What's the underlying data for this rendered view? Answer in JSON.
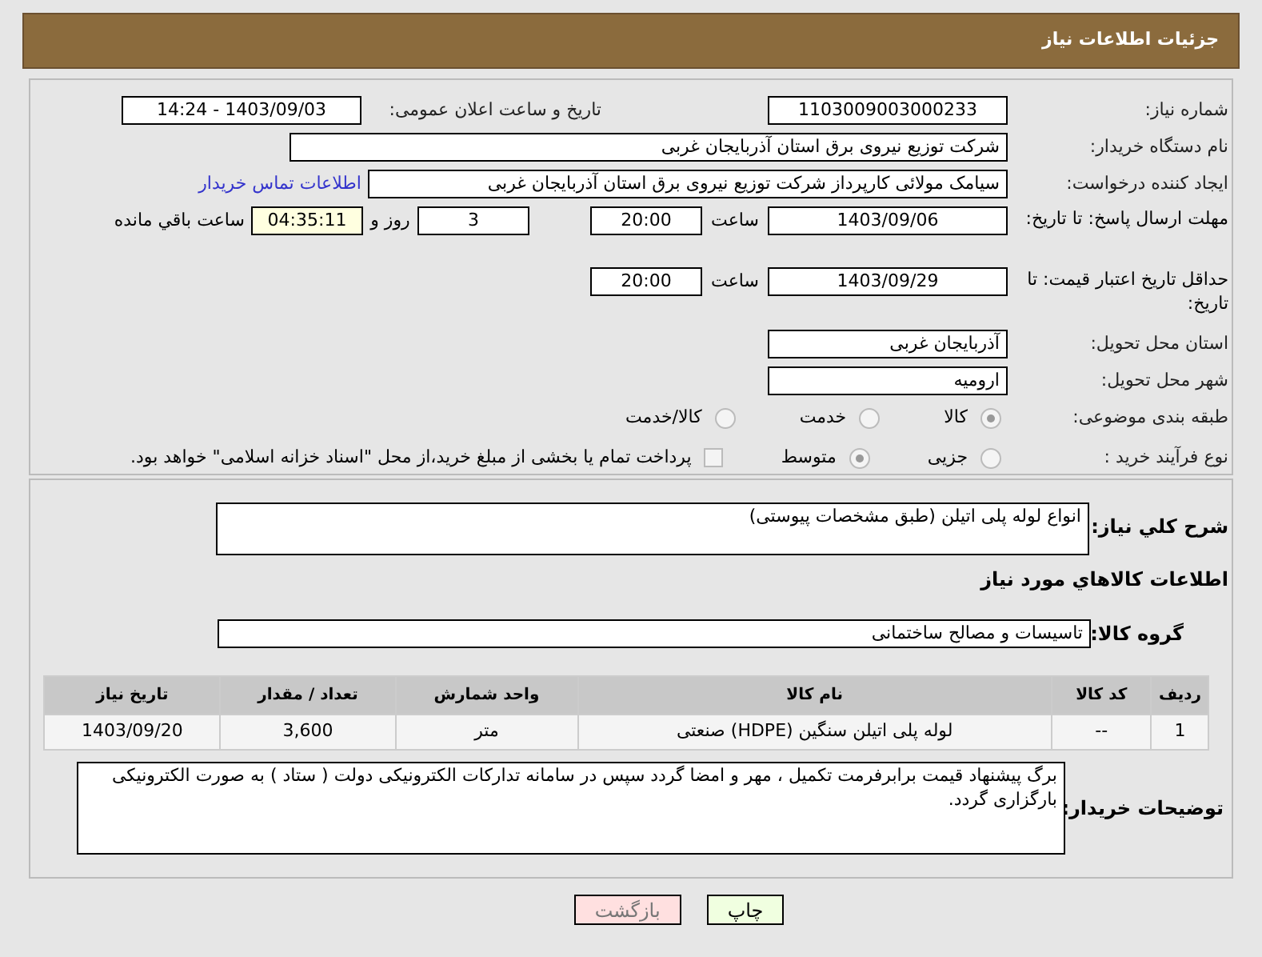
{
  "header": {
    "title": "جزئیات اطلاعات نیاز"
  },
  "need_number": {
    "label": "شماره نیاز:",
    "value": "1103009003000233"
  },
  "announce": {
    "label": "تاریخ و ساعت اعلان عمومی:",
    "value": "1403/09/03 - 14:24"
  },
  "buyer": {
    "label": "نام دستگاه خریدار:",
    "value": "شرکت توزیع نیروی برق استان آذربایجان غربی"
  },
  "creator": {
    "label": "ایجاد کننده درخواست:",
    "value": "سیامک مولائی کارپرداز شرکت توزیع نیروی برق استان آذربایجان غربی",
    "link": "اطلاعات تماس خریدار"
  },
  "deadline": {
    "label": "مهلت ارسال پاسخ: تا تاریخ:",
    "date": "1403/09/06",
    "time_label": "ساعت",
    "time": "20:00",
    "days": "3",
    "days_label": "روز و",
    "remaining": "04:35:11",
    "remaining_label": "ساعت باقي مانده"
  },
  "validity": {
    "label": "حداقل تاریخ اعتبار قیمت: تا تاریخ:",
    "date": "1403/09/29",
    "time_label": "ساعت",
    "time": "20:00"
  },
  "province": {
    "label": "استان محل تحویل:",
    "value": "آذربایجان غربی"
  },
  "city": {
    "label": "شهر محل تحویل:",
    "value": "ارومیه"
  },
  "category": {
    "label": "طبقه بندی موضوعی:",
    "options": [
      {
        "label": "کالا",
        "selected": true
      },
      {
        "label": "خدمت",
        "selected": false
      },
      {
        "label": "کالا/خدمت",
        "selected": false
      }
    ]
  },
  "process": {
    "label": "نوع فرآیند خرید :",
    "options": [
      {
        "kind": "radio",
        "label": "جزیی",
        "selected": false
      },
      {
        "kind": "radio",
        "label": "متوسط",
        "selected": true
      },
      {
        "kind": "checkbox",
        "label": "پرداخت تمام یا بخشی از مبلغ خرید،از محل \"اسناد خزانه اسلامی\" خواهد بود.",
        "checked": false
      }
    ]
  },
  "description": {
    "label": "شرح کلي نیاز:",
    "value": "انواع لوله پلی اتیلن (طبق مشخصات پیوستی)"
  },
  "items_heading": "اطلاعات کالاهاي مورد نیاز",
  "group": {
    "label": "گروه کالا:",
    "value": "تاسیسات و مصالح ساختمانی"
  },
  "table": {
    "columns": [
      "ردیف",
      "کد کالا",
      "نام کالا",
      "واحد شمارش",
      "تعداد / مقدار",
      "تاریخ نیاز"
    ],
    "rows": [
      [
        "1",
        "--",
        "لوله پلی اتیلن سنگین (HDPE) صنعتی",
        "متر",
        "3,600",
        "1403/09/20"
      ]
    ]
  },
  "notes": {
    "label": "توضیحات خریدار:",
    "value": "برگ پیشنهاد قیمت برابرفرمت تکمیل ، مهر و امضا گردد سپس در سامانه تداركات الكترونيكی دولت ( ستاد ) به صورت الکترونیکی  بارگزاری گردد."
  },
  "buttons": [
    {
      "kind": "print",
      "label": "چاپ"
    },
    {
      "kind": "back",
      "label": "بازگشت"
    }
  ]
}
